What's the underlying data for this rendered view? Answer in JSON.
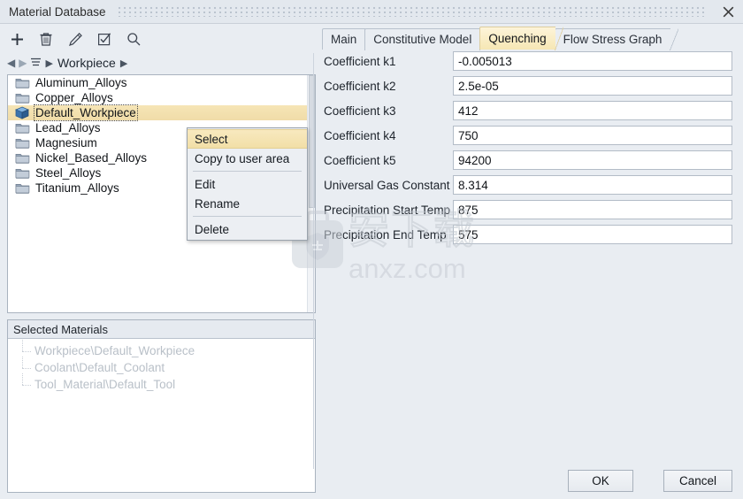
{
  "window": {
    "title": "Material Database",
    "close_icon": "close-x-icon",
    "grip_icon": "drag-grip-dots"
  },
  "toolbar": {
    "buttons": [
      {
        "name": "add-button",
        "icon": "plus-icon",
        "label": "+"
      },
      {
        "name": "delete-button",
        "icon": "trash-icon",
        "label": "Delete"
      },
      {
        "name": "edit-button",
        "icon": "pencil-icon",
        "label": "Edit"
      },
      {
        "name": "check-button",
        "icon": "checkbox-icon",
        "label": "Check"
      },
      {
        "name": "search-button",
        "icon": "magnifier-icon",
        "label": "Search"
      }
    ]
  },
  "breadcrumb": {
    "back_icon": "arrow-left-icon",
    "forward_icon": "arrow-right-icon",
    "menu_icon": "hamburger-icon",
    "separator": "▶",
    "items": [
      "Workpiece"
    ]
  },
  "tree": {
    "items": [
      {
        "label": "Aluminum_Alloys",
        "icon": "folder-icon",
        "selected": false
      },
      {
        "label": "Copper_Alloys",
        "icon": "folder-icon",
        "selected": false
      },
      {
        "label": "Default_Workpiece",
        "icon": "cube-icon",
        "selected": true
      },
      {
        "label": "Lead_Alloys",
        "icon": "folder-icon",
        "selected": false
      },
      {
        "label": "Magnesium",
        "icon": "folder-icon",
        "selected": false
      },
      {
        "label": "Nickel_Based_Alloys",
        "icon": "folder-icon",
        "selected": false
      },
      {
        "label": "Steel_Alloys",
        "icon": "folder-icon",
        "selected": false
      },
      {
        "label": "Titanium_Alloys",
        "icon": "folder-icon",
        "selected": false
      }
    ]
  },
  "context_menu": {
    "items": [
      {
        "label": "Select",
        "highlight": true,
        "separator_after": false
      },
      {
        "label": "Copy to user area",
        "highlight": false,
        "separator_after": true
      },
      {
        "label": "Edit",
        "highlight": false,
        "separator_after": false
      },
      {
        "label": "Rename",
        "highlight": false,
        "separator_after": true
      },
      {
        "label": "Delete",
        "highlight": false,
        "separator_after": false
      }
    ]
  },
  "selected_materials": {
    "header": "Selected Materials",
    "items": [
      "Workpiece\\Default_Workpiece",
      "Coolant\\Default_Coolant",
      "Tool_Material\\Default_Tool"
    ]
  },
  "tabs": [
    {
      "label": "Main",
      "active": false
    },
    {
      "label": "Constitutive Model",
      "active": false
    },
    {
      "label": "Quenching",
      "active": true
    },
    {
      "label": "Flow Stress Graph",
      "active": false
    }
  ],
  "form": {
    "rows": [
      {
        "label": "Coefficient k1",
        "value": "-0.005013"
      },
      {
        "label": "Coefficient k2",
        "value": "2.5e-05"
      },
      {
        "label": "Coefficient k3",
        "value": "412"
      },
      {
        "label": "Coefficient k4",
        "value": "750"
      },
      {
        "label": "Coefficient k5",
        "value": "94200"
      },
      {
        "label": "Universal Gas Constant",
        "value": "8.314"
      },
      {
        "label": "Precipitation Start Temp",
        "value": "875"
      },
      {
        "label": "Precipitation End Temp",
        "value": "575"
      }
    ]
  },
  "footer": {
    "ok_label": "OK",
    "cancel_label": "Cancel"
  },
  "watermark": {
    "chinese": "安下载",
    "site": "anxz.com",
    "icon": "shield-bag-icon"
  },
  "colors": {
    "window_bg": "#e9edf2",
    "titlebar_bg": "#e3e8ee",
    "accent_selection": "#f2dfa7",
    "border": "#a9b3bf",
    "field_bg": "#ffffff",
    "muted_text": "#b9c0c8"
  }
}
